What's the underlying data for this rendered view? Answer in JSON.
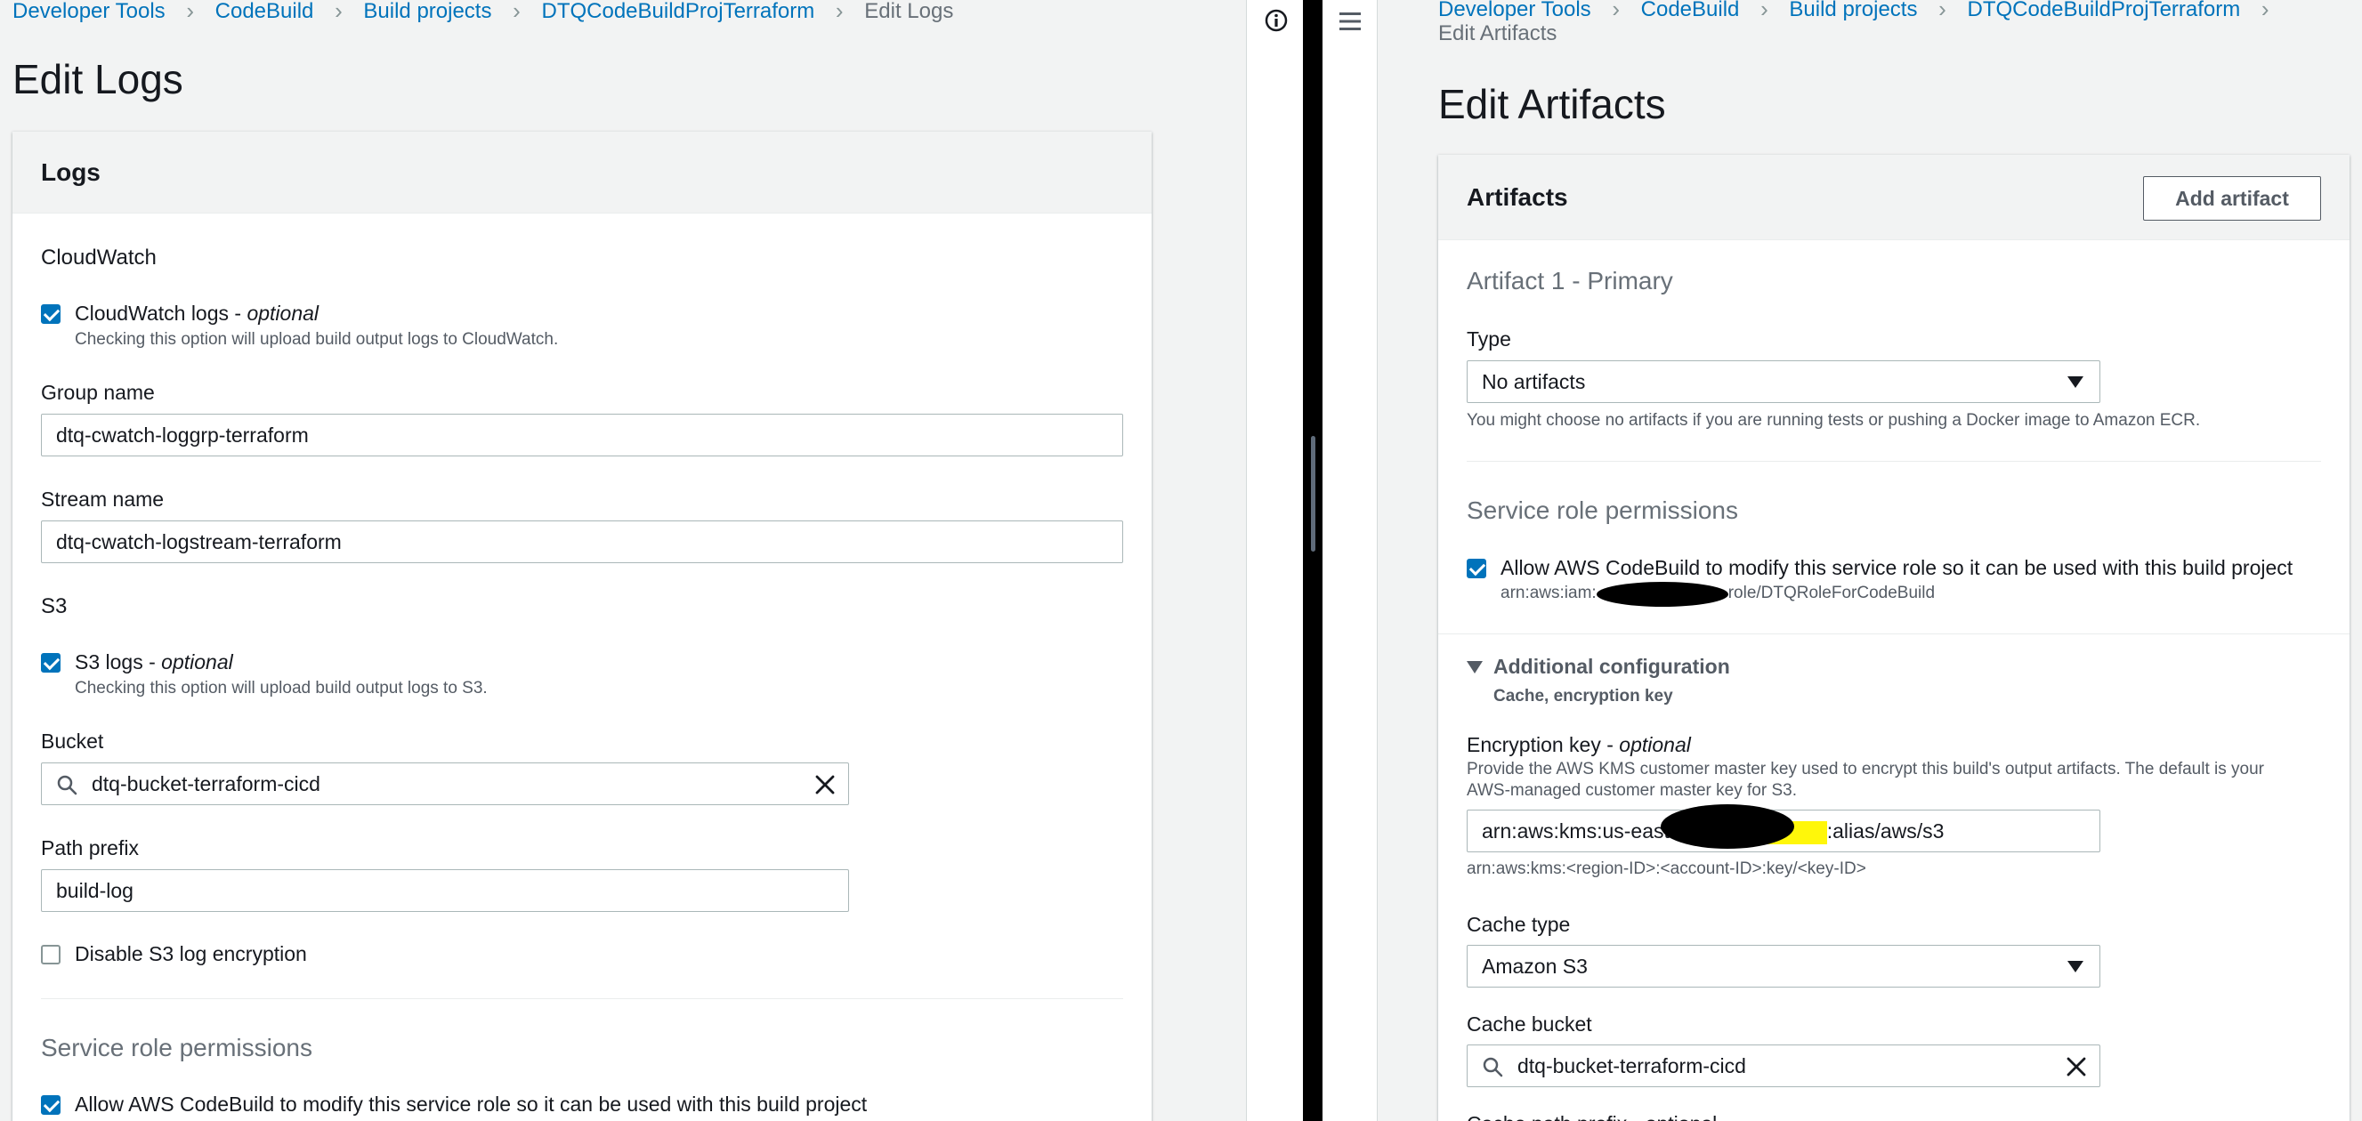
{
  "left": {
    "breadcrumb": [
      "Developer Tools",
      "CodeBuild",
      "Build projects",
      "DTQCodeBuildProjTerraform",
      "Edit Logs"
    ],
    "title": "Edit Logs",
    "panel_title": "Logs",
    "cloudwatch": {
      "section": "CloudWatch",
      "checkbox_label": "CloudWatch logs - ",
      "optional": "optional",
      "checked": true,
      "hint": "Checking this option will upload build output logs to CloudWatch.",
      "group_label": "Group name",
      "group_value": "dtq-cwatch-loggrp-terraform",
      "stream_label": "Stream name",
      "stream_value": "dtq-cwatch-logstream-terraform"
    },
    "s3": {
      "section": "S3",
      "checkbox_label": "S3 logs - ",
      "optional": "optional",
      "checked": true,
      "hint": "Checking this option will upload build output logs to S3.",
      "bucket_label": "Bucket",
      "bucket_value": "dtq-bucket-terraform-cicd",
      "prefix_label": "Path prefix",
      "prefix_value": "build-log",
      "disable_label": "Disable S3 log encryption",
      "disable_checked": false
    },
    "service_role": {
      "heading": "Service role permissions",
      "checkbox_label": "Allow AWS CodeBuild to modify this service role so it can be used with this build project",
      "checked": true
    }
  },
  "right": {
    "breadcrumb": [
      "Developer Tools",
      "CodeBuild",
      "Build projects",
      "DTQCodeBuildProjTerraform"
    ],
    "breadcrumb_current": "Edit Artifacts",
    "title": "Edit Artifacts",
    "panel_title": "Artifacts",
    "add_button": "Add artifact",
    "artifact_heading": "Artifact 1 - Primary",
    "type_label": "Type",
    "type_value": "No artifacts",
    "type_hint": "You might choose no artifacts if you are running tests or pushing a Docker image to Amazon ECR.",
    "service_role": {
      "heading": "Service role permissions",
      "checkbox_label": "Allow AWS CodeBuild to modify this service role so it can be used with this build project",
      "checked": true,
      "arn_prefix": "arn:aws:iam:",
      "arn_suffix": "role/DTQRoleForCodeBuild"
    },
    "additional": {
      "title": "Additional configuration",
      "subtitle": "Cache, encryption key"
    },
    "encryption": {
      "label": "Encryption key - ",
      "optional": "optional",
      "hint_line1": "Provide the AWS KMS customer master key used to encrypt this build's output artifacts. The default is your",
      "hint_line2": "AWS-managed customer master key for S3.",
      "value_prefix": "arn:aws:kms:us-east-1:",
      "value_suffix": ":alias/aws/s3",
      "format_hint": "arn:aws:kms:<region-ID>:<account-ID>:key/<key-ID>"
    },
    "cache_type_label": "Cache type",
    "cache_type_value": "Amazon S3",
    "cache_bucket_label": "Cache bucket",
    "cache_bucket_value": "dtq-bucket-terraform-cicd",
    "cache_path_label": "Cache path prefix - optional"
  },
  "icons": {
    "info": "info-icon",
    "menu": "hamburger-menu-icon",
    "search": "search-icon",
    "clear": "close-icon",
    "dropdown": "caret-down-icon"
  },
  "colors": {
    "link": "#0073bb",
    "checkbox": "#0073bb",
    "text": "#16191f",
    "muted": "#687078",
    "highlight": "#fff70a"
  }
}
